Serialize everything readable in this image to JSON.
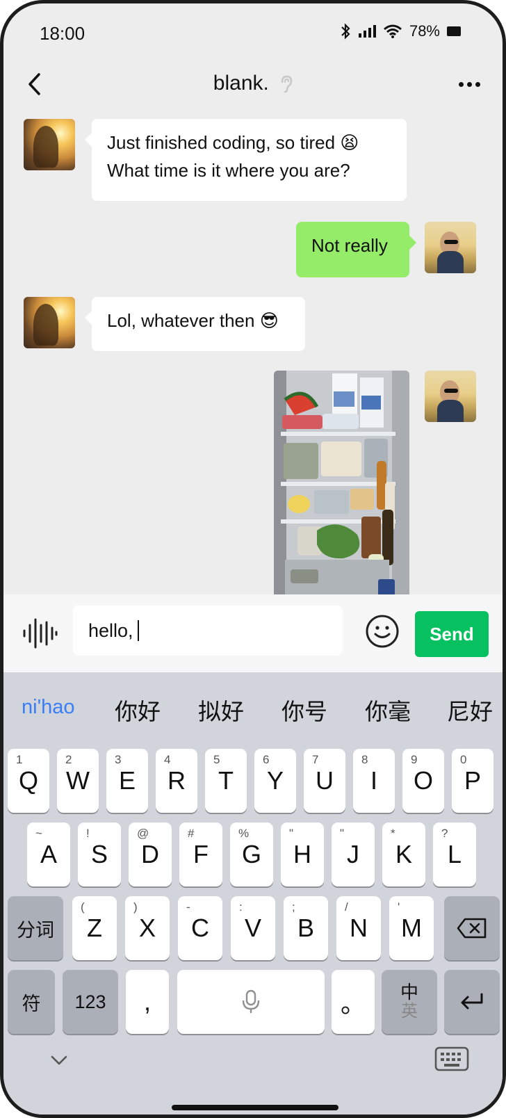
{
  "status_bar": {
    "time": "18:00",
    "battery": "78%"
  },
  "header": {
    "title": "blank."
  },
  "messages": [
    {
      "from": "them",
      "lines": [
        "Just finished coding, so tired 😫",
        "What time is it where you are?"
      ]
    },
    {
      "from": "me",
      "text": "Not really"
    },
    {
      "from": "them",
      "text": "Lol, whatever then 😎"
    },
    {
      "from": "me",
      "type": "photo"
    }
  ],
  "input": {
    "value": "hello,",
    "send_label": "Send"
  },
  "keyboard": {
    "candidates": [
      "ni'hao",
      "你好",
      "拟好",
      "你号",
      "你毫",
      "尼好"
    ],
    "row1": [
      {
        "hint": "1",
        "key": "Q"
      },
      {
        "hint": "2",
        "key": "W"
      },
      {
        "hint": "3",
        "key": "E"
      },
      {
        "hint": "4",
        "key": "R"
      },
      {
        "hint": "5",
        "key": "T"
      },
      {
        "hint": "6",
        "key": "Y"
      },
      {
        "hint": "7",
        "key": "U"
      },
      {
        "hint": "8",
        "key": "I"
      },
      {
        "hint": "9",
        "key": "O"
      },
      {
        "hint": "0",
        "key": "P"
      }
    ],
    "row2": [
      {
        "hint": "~",
        "key": "A"
      },
      {
        "hint": "!",
        "key": "S"
      },
      {
        "hint": "@",
        "key": "D"
      },
      {
        "hint": "#",
        "key": "F"
      },
      {
        "hint": "%",
        "key": "G"
      },
      {
        "hint": "\"",
        "key": "H"
      },
      {
        "hint": "\"",
        "key": "J"
      },
      {
        "hint": "*",
        "key": "K"
      },
      {
        "hint": "?",
        "key": "L"
      }
    ],
    "row3": [
      {
        "hint": "(",
        "key": "Z"
      },
      {
        "hint": ")",
        "key": "X"
      },
      {
        "hint": "-",
        "key": "C"
      },
      {
        "hint": ":",
        "key": "V"
      },
      {
        "hint": ";",
        "key": "B"
      },
      {
        "hint": "/",
        "key": "N"
      },
      {
        "hint": "'",
        "key": "M"
      }
    ],
    "segment_label": "分词",
    "symbols_label": "符",
    "numbers_label": "123",
    "comma": ",",
    "period": "。",
    "lang_zh": "中",
    "lang_en": "英"
  },
  "colors": {
    "send": "#07c160",
    "bubble_out": "#95ec69",
    "pinyin": "#3a7ef6"
  },
  "icons": [
    "back-arrow-icon",
    "ear-icon",
    "more-icon",
    "voice-wave-icon",
    "emoji-icon",
    "backspace-icon",
    "mic-icon",
    "return-icon",
    "chevron-down-icon",
    "keyboard-icon"
  ]
}
